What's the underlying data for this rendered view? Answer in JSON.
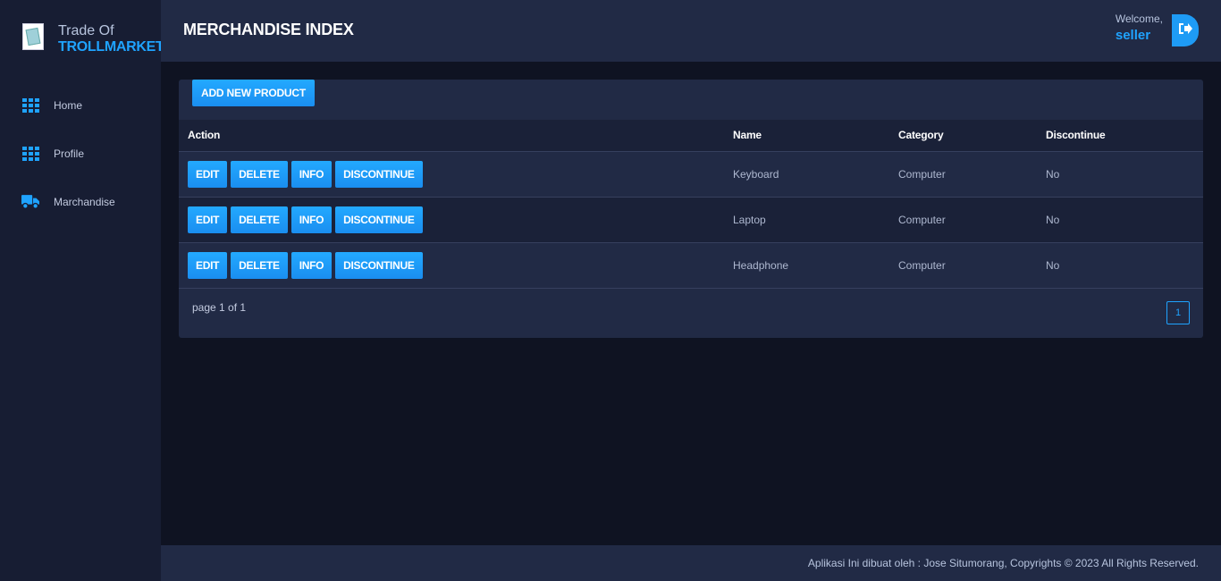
{
  "brand": {
    "line1": "Trade Of",
    "line2": "TROLLMARKET"
  },
  "sidebar": {
    "items": [
      {
        "label": "Home",
        "icon": "grid-icon"
      },
      {
        "label": "Profile",
        "icon": "grid-icon"
      },
      {
        "label": "Marchandise",
        "icon": "truck-icon"
      }
    ]
  },
  "header": {
    "title": "MERCHANDISE INDEX",
    "welcome_label": "Welcome,",
    "username": "seller",
    "logout_icon": "logout-icon"
  },
  "toolbar": {
    "add_label": "ADD NEW PRODUCT"
  },
  "table": {
    "columns": [
      "Action",
      "Name",
      "Category",
      "Discontinue"
    ],
    "action_labels": {
      "edit": "EDIT",
      "delete": "DELETE",
      "info": "INFO",
      "discontinue": "DISCONTINUE"
    },
    "rows": [
      {
        "name": "Keyboard",
        "category": "Computer",
        "discontinue": "No"
      },
      {
        "name": "Laptop",
        "category": "Computer",
        "discontinue": "No"
      },
      {
        "name": "Headphone",
        "category": "Computer",
        "discontinue": "No"
      }
    ]
  },
  "pagination": {
    "summary": "page 1 of 1",
    "current": "1"
  },
  "footer": {
    "text": "Aplikasi Ini dibuat oleh : Jose Situmorang, Copyrights © 2023 All Rights Reserved."
  },
  "colors": {
    "accent": "#1fa3ff",
    "background": "#0f1322",
    "panel": "#212a45",
    "sidebar": "#171d33"
  }
}
